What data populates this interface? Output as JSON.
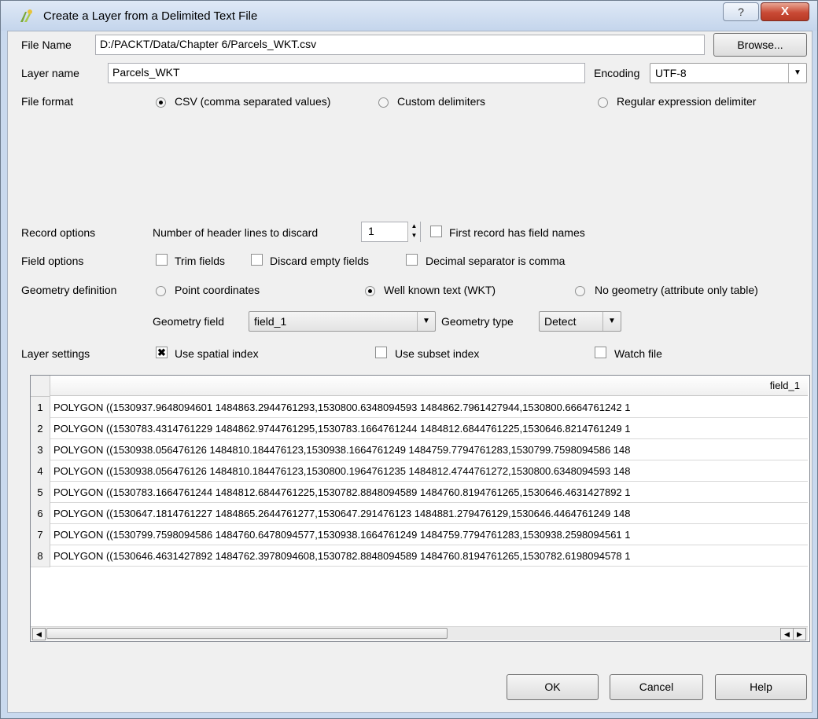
{
  "window": {
    "title": "Create a Layer from a Delimited Text File",
    "help_glyph": "?",
    "close_glyph": "X"
  },
  "file": {
    "label": "File Name",
    "value": "D:/PACKT/Data/Chapter 6/Parcels_WKT.csv",
    "browse_label": "Browse..."
  },
  "layer": {
    "label": "Layer name",
    "value": "Parcels_WKT",
    "encoding_label": "Encoding",
    "encoding_value": "UTF-8"
  },
  "file_format": {
    "label": "File format",
    "options": [
      {
        "label": "CSV (comma separated values)",
        "selected": true
      },
      {
        "label": "Custom delimiters",
        "selected": false
      },
      {
        "label": "Regular expression delimiter",
        "selected": false
      }
    ]
  },
  "record_options": {
    "label": "Record options",
    "header_lines_label": "Number of header lines to discard",
    "header_lines_value": "1",
    "first_record_label": "First record has field names",
    "first_record_checked": false
  },
  "field_options": {
    "label": "Field options",
    "trim_label": "Trim fields",
    "discard_label": "Discard empty fields",
    "decimal_label": "Decimal separator is comma"
  },
  "geometry": {
    "label": "Geometry definition",
    "options": [
      {
        "label": "Point coordinates",
        "selected": false
      },
      {
        "label": "Well known text (WKT)",
        "selected": true
      },
      {
        "label": "No geometry (attribute only table)",
        "selected": false
      }
    ],
    "field_label": "Geometry field",
    "field_value": "field_1",
    "type_label": "Geometry type",
    "type_value": "Detect"
  },
  "layer_settings": {
    "label": "Layer settings",
    "spatial_index_label": "Use spatial index",
    "spatial_index_checked": true,
    "subset_index_label": "Use subset index",
    "watch_file_label": "Watch file"
  },
  "table": {
    "columns": [
      "field_1"
    ],
    "rows": [
      {
        "num": "1",
        "value": "POLYGON ((1530937.9648094601 1484863.2944761293,1530800.6348094593 1484862.7961427944,1530800.6664761242 1"
      },
      {
        "num": "2",
        "value": "POLYGON ((1530783.4314761229 1484862.9744761295,1530783.1664761244 1484812.6844761225,1530646.8214761249 1"
      },
      {
        "num": "3",
        "value": "POLYGON ((1530938.056476126 1484810.184476123,1530938.1664761249 1484759.7794761283,1530799.7598094586 148"
      },
      {
        "num": "4",
        "value": "POLYGON ((1530938.056476126 1484810.184476123,1530800.1964761235 1484812.4744761272,1530800.6348094593 148"
      },
      {
        "num": "5",
        "value": "POLYGON ((1530783.1664761244 1484812.6844761225,1530782.8848094589 1484760.8194761265,1530646.4631427892 1"
      },
      {
        "num": "6",
        "value": "POLYGON ((1530647.1814761227 1484865.2644761277,1530647.291476123 1484881.279476129,1530646.4464761249 148"
      },
      {
        "num": "7",
        "value": "POLYGON ((1530799.7598094586 1484760.6478094577,1530938.1664761249 1484759.7794761283,1530938.2598094561 1"
      },
      {
        "num": "8",
        "value": "POLYGON ((1530646.4631427892 1484762.3978094608,1530782.8848094589 1484760.8194761265,1530782.6198094578 1"
      }
    ]
  },
  "buttons": {
    "ok": "OK",
    "cancel": "Cancel",
    "help": "Help"
  }
}
